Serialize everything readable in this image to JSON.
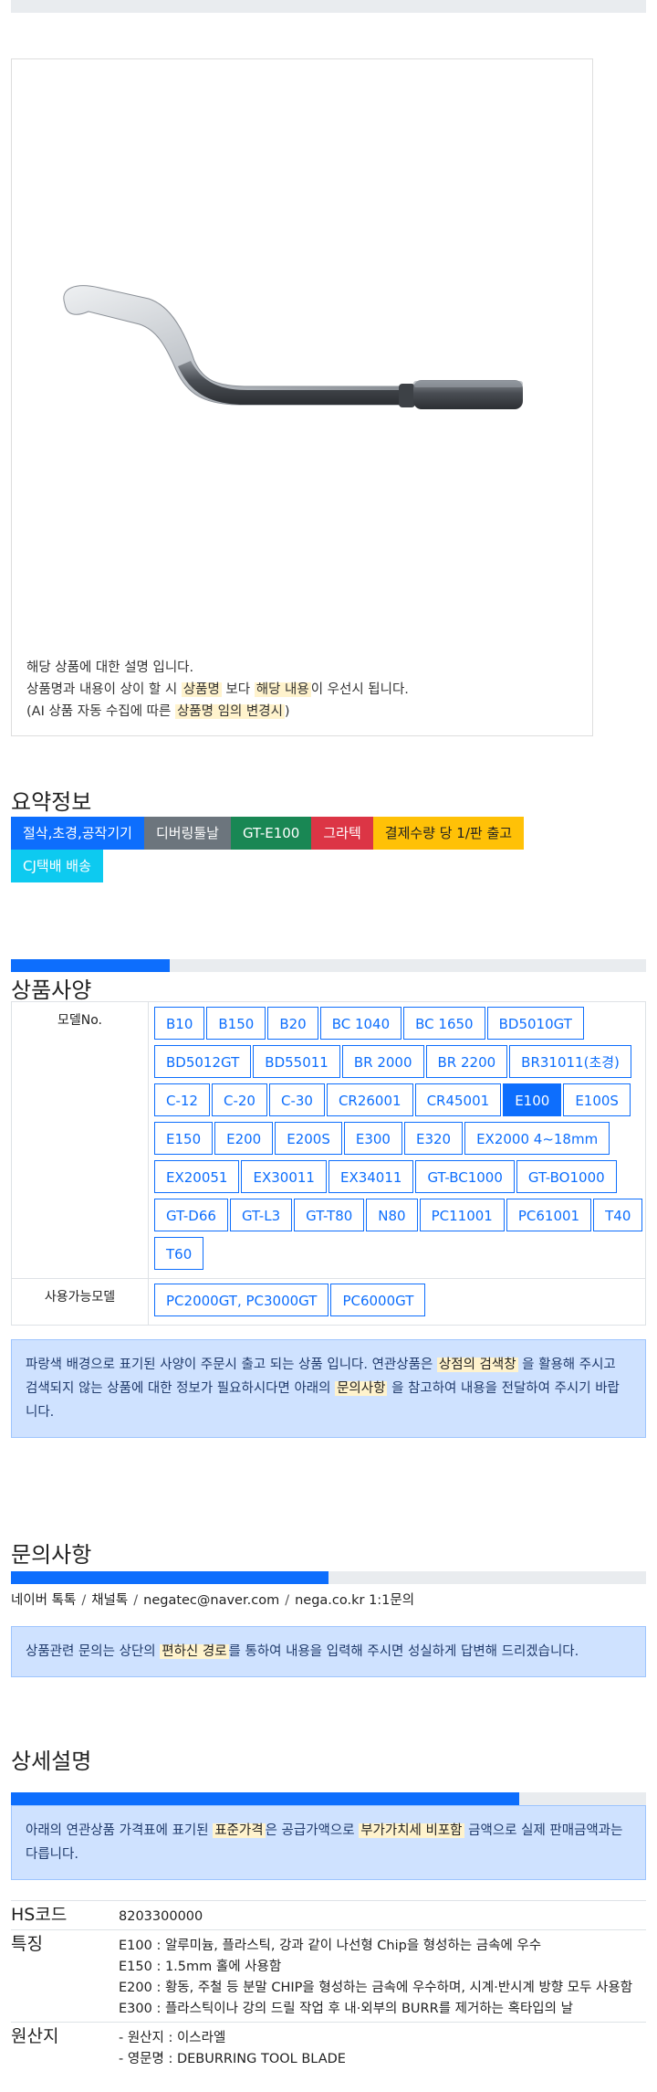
{
  "product_image": {
    "description_lines": [
      {
        "text": "해당 상품에 대한 설명 입니다."
      },
      {
        "pre": "상품명과 내용이 상이 할 시 ",
        "h1": "상품명",
        "mid": " 보다 ",
        "h2": "해당 내용",
        "post": "이 우선시 됩니다."
      },
      {
        "pre": "(AI 상품 자동 수집에 따른 ",
        "h1": "상품명 임의 변경시",
        "post": ")"
      }
    ]
  },
  "summary": {
    "title": "요약정보",
    "badges": [
      {
        "label": "절삭,초경,공작기기",
        "color": "#0d6efd"
      },
      {
        "label": "디버링툴날",
        "color": "#6c757d"
      },
      {
        "label": "GT-E100",
        "color": "#198754"
      },
      {
        "label": "그라텍",
        "color": "#dc3545"
      },
      {
        "label": "결제수량 당 1/판 출고",
        "color": "#ffc107"
      },
      {
        "label": "CJ택배 배송",
        "color": "#0dcaf0"
      }
    ]
  },
  "spec": {
    "title": "상품사양",
    "progress": 0.25,
    "model_label": "모델No.",
    "models": [
      "B10",
      "B150",
      "B20",
      "BC 1040",
      "BC 1650",
      "BD5010GT",
      "BD5012GT",
      "BD55011",
      "BR 2000",
      "BR 2200",
      "BR31011(초경)",
      "C-12",
      "C-20",
      "C-30",
      "CR26001",
      "CR45001",
      "E100",
      "E100S",
      "E150",
      "E200",
      "E200S",
      "E300",
      "E320",
      "EX2000 4~18mm",
      "EX20051",
      "EX30011",
      "EX34011",
      "GT-BC1000",
      "GT-BO1000",
      "GT-D66",
      "GT-L3",
      "GT-T80",
      "N80",
      "PC11001",
      "PC61001",
      "T40",
      "T60"
    ],
    "active_model": "E100",
    "compatible_label": "사용가능모델",
    "compatible": [
      "PC2000GT, PC3000GT",
      "PC6000GT"
    ],
    "notice": {
      "pre": "파랑색 배경으로 표기된 사양이 주문시 출고 되는 상품 입니다. 연관상품은 ",
      "h1": "상점의 검색창",
      "mid": " 을 활용해 주시고 검색되지 않는 상품에 대한 정보가 필요하시다면 아래의 ",
      "h2": "문의사항",
      "post": " 을 참고하여 내용을 전달하여 주시기 바랍니다."
    }
  },
  "inquiry": {
    "title": "문의사항",
    "progress": 0.5,
    "contacts": [
      "네이버 톡톡",
      "채널톡",
      "negatec@naver.com",
      "nega.co.kr 1:1문의"
    ],
    "separator": "/",
    "notice": {
      "pre": "상품관련 문의는 상단의 ",
      "h1": "편하신 경로",
      "post": "를 통하여 내용을 입력해 주시면 성실하게 답변해 드리겠습니다."
    }
  },
  "detail": {
    "title": "상세설명",
    "progress": 0.8,
    "notice": {
      "pre": "아래의 연관상품 가격표에 표기된 ",
      "h1": "표준가격",
      "mid": "은 공급가액으로 ",
      "h2": "부가가치세 비포함",
      "post": " 금액으로 실제 판매금액과는 다릅니다."
    },
    "rows": [
      {
        "key": "HS코드",
        "lines": [
          "8203300000"
        ]
      },
      {
        "key": "특징",
        "lines": [
          "E100 : 알루미늄, 플라스틱, 강과 같이 나선형 Chip을 형성하는 금속에 우수",
          "E150 : 1.5mm 홀에 사용함",
          "E200 : 황동, 주철 등 분말 CHIP을 형성하는 금속에 우수하며, 시계·반시계 방향 모두 사용함",
          "E300 : 플라스틱이나 강의 드릴 작업 후 내·외부의 BURR를 제거하는 혹타입의 날"
        ]
      },
      {
        "key": "원산지",
        "lines": [
          "- 원산지 : 이스라엘",
          "- 영문명 : DEBURRING TOOL BLADE"
        ]
      }
    ]
  }
}
